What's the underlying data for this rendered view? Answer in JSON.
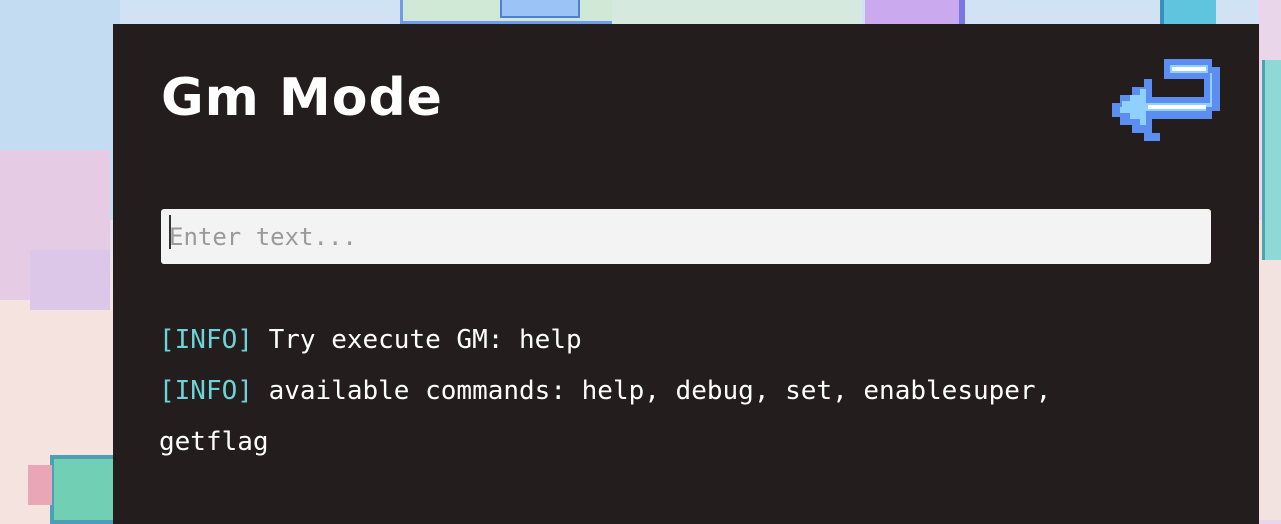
{
  "dialog": {
    "title": "Gm Mode",
    "back_icon": "return-arrow-icon"
  },
  "command_input": {
    "placeholder": "Enter text...",
    "value": ""
  },
  "log": {
    "lines": [
      {
        "tag": "[INFO]",
        "text": " Try execute GM: help"
      },
      {
        "tag": "[INFO]",
        "text": " available commands: help, debug, set, enablesuper, getflag"
      }
    ]
  },
  "colors": {
    "panel_bg": "#231d1e",
    "title": "#ffffff",
    "info_tag": "#6ed3d8",
    "log_text": "#ffffff",
    "input_bg": "#f3f3f3",
    "back_icon_light": "#8fd0ff",
    "back_icon_dark": "#5c8ef2"
  }
}
